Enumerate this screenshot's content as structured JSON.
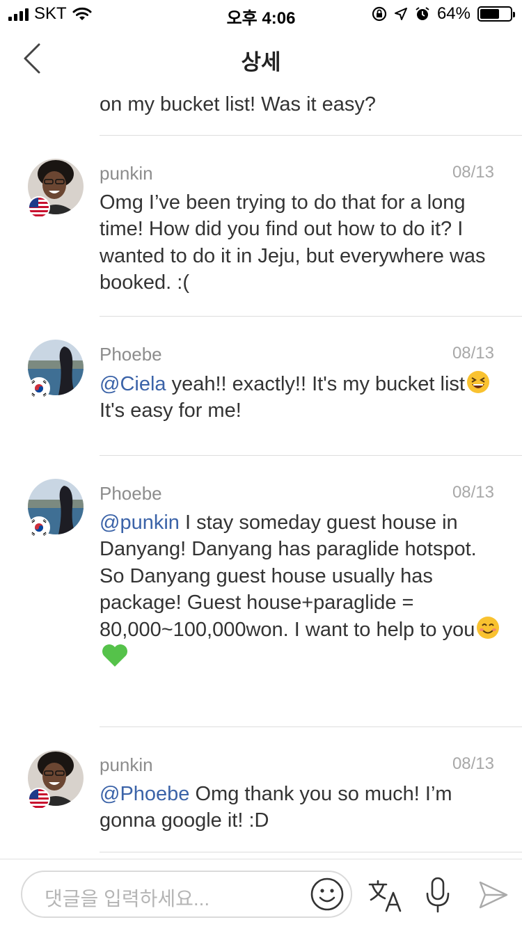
{
  "status_bar": {
    "carrier": "SKT",
    "time": "오후 4:06",
    "battery_percent": "64%",
    "battery_level": 0.64,
    "icons": [
      "signal-icon",
      "wifi-icon",
      "orientation-lock-icon",
      "location-icon",
      "alarm-icon",
      "battery-icon"
    ]
  },
  "nav": {
    "title": "상세",
    "back_icon": "chevron-left-icon"
  },
  "partial_comment": {
    "text": "on my bucket list! Was it easy?"
  },
  "comments": [
    {
      "username": "punkin",
      "date": "08/13",
      "mention": "",
      "text": "Omg I’ve been trying to do that for a long time! How did you find out how to do it? I wanted to do it in Jeju, but everywhere was booked. :(",
      "flag": "us-flag-icon"
    },
    {
      "username": "Phoebe",
      "date": "08/13",
      "mention": "@Ciela",
      "text_before_emoji": " yeah!! exactly!! It's my bucket list",
      "emoji": "grinning-squinting-face-icon",
      "text_after_emoji": "  It's easy for me!",
      "flag": "kr-flag-icon"
    },
    {
      "username": "Phoebe",
      "date": "08/13",
      "mention": "@punkin",
      "text": " I stay someday guest house in Danyang! Danyang has paraglide hotspot. So Danyang guest house usually has package! Guest house+paraglide = 80,000~100,000won. I want to help to you",
      "emojis": [
        "smiling-face-icon",
        "green-heart-icon"
      ],
      "flag": "kr-flag-icon"
    },
    {
      "username": "punkin",
      "date": "08/13",
      "mention": "@Phoebe",
      "text": " Omg thank you so much! I’m gonna google it! :D",
      "flag": "us-flag-icon"
    }
  ],
  "input_bar": {
    "placeholder": "댓글을 입력하세요...",
    "icons": [
      "smile-icon",
      "translate-icon",
      "microphone-icon",
      "send-icon"
    ]
  },
  "colors": {
    "mention": "#3b63a8",
    "text": "#333333",
    "meta": "#8c8c8c",
    "divider": "#dddddd"
  }
}
